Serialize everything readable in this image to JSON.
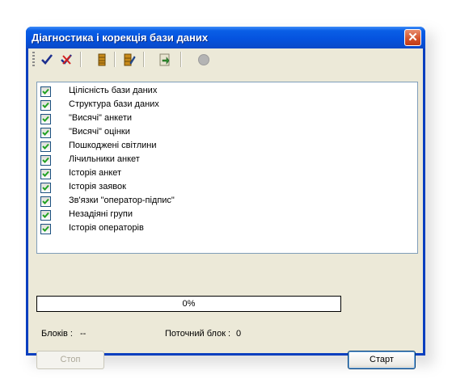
{
  "window": {
    "title": "Діагностика і корекція бази даних"
  },
  "toolbar": {
    "buttons": [
      {
        "name": "check-all",
        "icon": "checkmark-icon"
      },
      {
        "name": "uncheck-all",
        "icon": "cross-check-icon"
      },
      {
        "name": "database",
        "icon": "database-icon"
      },
      {
        "name": "database-edit",
        "icon": "database-edit-icon"
      },
      {
        "name": "export",
        "icon": "export-icon"
      },
      {
        "name": "stop",
        "icon": "stop-circle-icon"
      }
    ]
  },
  "checks": [
    {
      "label": "Цілісність бази даних",
      "checked": true
    },
    {
      "label": "Структура бази даних",
      "checked": true
    },
    {
      "label": "\"Висячі\" анкети",
      "checked": true
    },
    {
      "label": "\"Висячі\" оцінки",
      "checked": true
    },
    {
      "label": "Пошкоджені світлини",
      "checked": true
    },
    {
      "label": "Лічильники анкет",
      "checked": true
    },
    {
      "label": "Історія анкет",
      "checked": true
    },
    {
      "label": "Історія заявок",
      "checked": true
    },
    {
      "label": "Зв'язки \"оператор-підпис\"",
      "checked": true
    },
    {
      "label": "Незадіяні групи",
      "checked": true
    },
    {
      "label": "Історія операторів",
      "checked": true
    }
  ],
  "progress": {
    "value": 0,
    "label": "0%"
  },
  "stats": {
    "blocks_label": "Блоків :",
    "blocks_value": "--",
    "current_label": "Поточний блок :",
    "current_value": "0"
  },
  "buttons": {
    "stop": "Стоп",
    "start": "Старт"
  },
  "colors": {
    "checkbox_check": "#21a121",
    "title_bar": "#0553df",
    "progress_fill": "#316ac5"
  }
}
